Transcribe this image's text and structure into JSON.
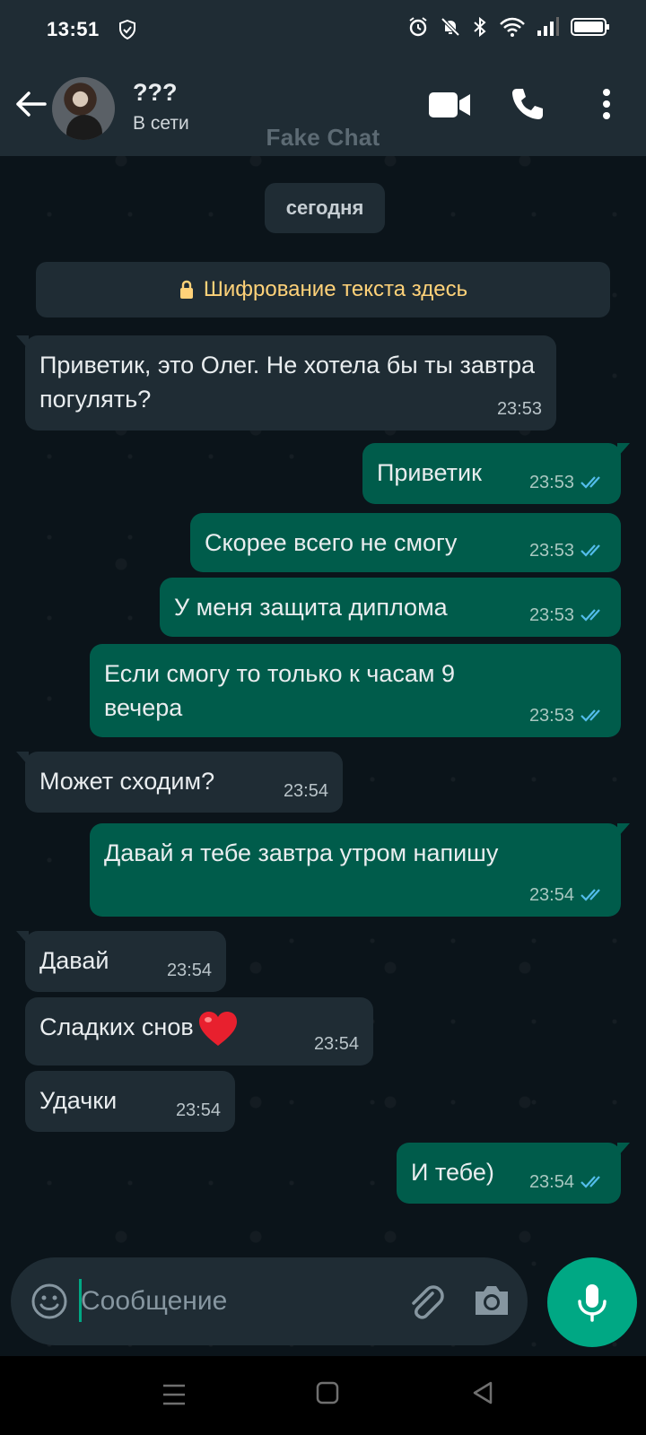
{
  "status_bar": {
    "time": "13:51",
    "icons": [
      "shield-icon",
      "alarm-icon",
      "mute-icon",
      "bluetooth-icon",
      "wifi-icon",
      "signal-icon",
      "battery-icon"
    ]
  },
  "header": {
    "contact_name": "???",
    "status": "В сети",
    "watermark": "Fake Chat",
    "icons": [
      "back-arrow-icon",
      "video-call-icon",
      "phone-icon",
      "more-vert-icon"
    ]
  },
  "chat": {
    "date_label": "сегодня",
    "encryption_notice": "Шифрование текста здесь",
    "messages": [
      {
        "direction": "in",
        "text": "Приветик, это Олег. Не хотела бы ты завтра погулять?",
        "time": "23:53"
      },
      {
        "direction": "out",
        "text": "Приветик",
        "time": "23:53",
        "read": true
      },
      {
        "direction": "out",
        "text": "Скорее всего не смогу",
        "time": "23:53",
        "read": true
      },
      {
        "direction": "out",
        "text": "У меня защита диплома",
        "time": "23:53",
        "read": true
      },
      {
        "direction": "out",
        "text": "Если смогу то только к часам 9 вечера",
        "time": "23:53",
        "read": true
      },
      {
        "direction": "in",
        "text": "Может сходим?",
        "time": "23:54"
      },
      {
        "direction": "out",
        "text": "Давай я тебе завтра утром напишу",
        "time": "23:54",
        "read": true
      },
      {
        "direction": "in",
        "text": "Давай",
        "time": "23:54"
      },
      {
        "direction": "in",
        "text": "Сладких снов",
        "emoji": "red-heart",
        "time": "23:54"
      },
      {
        "direction": "in",
        "text": "Удачки",
        "time": "23:54"
      },
      {
        "direction": "out",
        "text": "И тебе)",
        "time": "23:54",
        "read": true
      }
    ]
  },
  "composer": {
    "placeholder": "Сообщение",
    "value": ""
  },
  "colors": {
    "incoming_bubble": "#1f2c34",
    "outgoing_bubble": "#005c4b",
    "accent": "#00a884",
    "read_ticks": "#53bdeb",
    "encryption_text": "#ffd279"
  }
}
